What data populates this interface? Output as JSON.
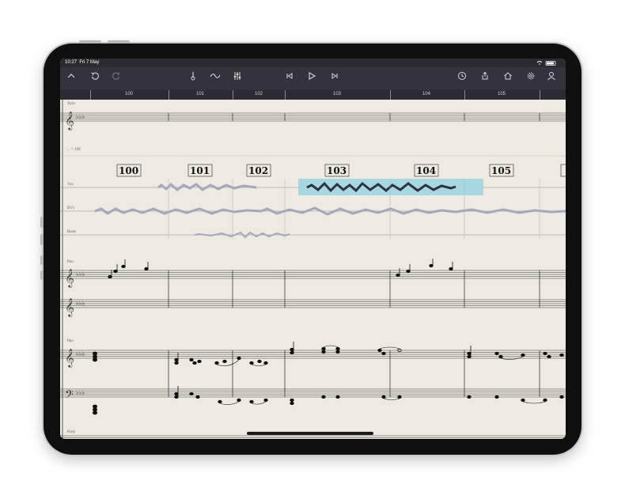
{
  "status_bar": {
    "time": "10:27",
    "date": "Fri 7 May"
  },
  "toolbar": {
    "icons": [
      "collapse-chevron-up-icon",
      "undo-icon",
      "redo-icon",
      "metronome-icon",
      "curve-icon",
      "mixer-icon",
      "skip-back-icon",
      "play-icon",
      "skip-forward-icon",
      "clock-icon",
      "share-icon",
      "home-icon",
      "settings-icon",
      "account-icon"
    ]
  },
  "ruler": {
    "bars": [
      "100",
      "101",
      "102",
      "103",
      "104",
      "105"
    ]
  },
  "score": {
    "instruments": {
      "xylo": "Xylo",
      "tempo": "♩= 108",
      "vox": "Vox",
      "bvs": "BVs",
      "beats": "Beats",
      "pno": "Pno",
      "ppo": "Ppo",
      "harp": "Harp"
    },
    "bar_numbers": [
      "100",
      "101",
      "102",
      "103",
      "104",
      "105"
    ]
  },
  "colors": {
    "selection": "#a7d8e2",
    "toolbar": "#34333c",
    "paper": "#efeae1"
  }
}
